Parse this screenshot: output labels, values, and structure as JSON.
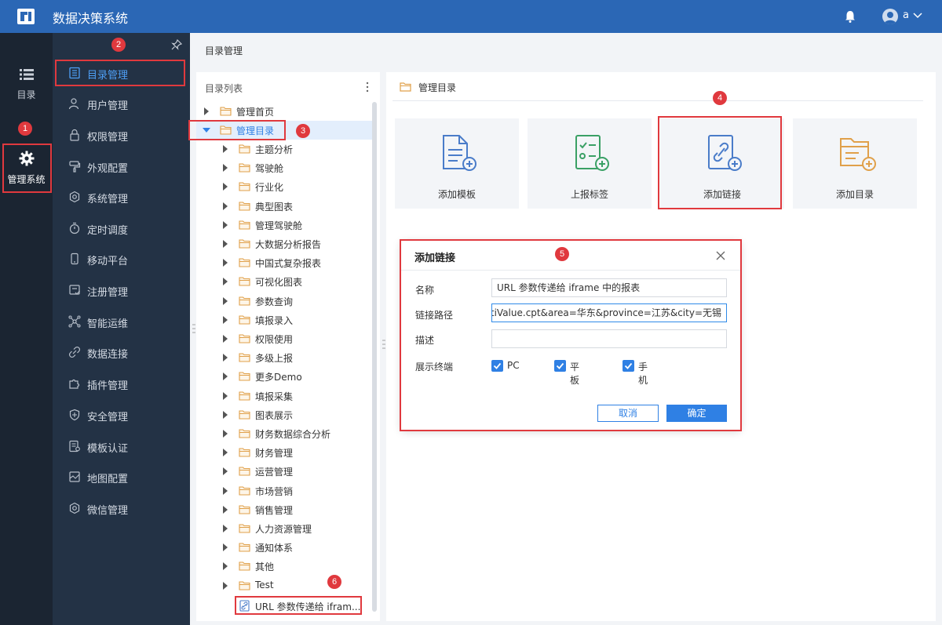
{
  "app": {
    "title": "数据决策系统",
    "user": "a"
  },
  "rail": [
    {
      "label": "目录",
      "icon": "list-icon"
    },
    {
      "label": "管理系统",
      "icon": "gear-icon"
    }
  ],
  "nav": [
    {
      "label": "目录管理",
      "icon": "doc-list-icon",
      "active": true
    },
    {
      "label": "用户管理",
      "icon": "user-icon"
    },
    {
      "label": "权限管理",
      "icon": "lock-icon"
    },
    {
      "label": "外观配置",
      "icon": "brush-icon"
    },
    {
      "label": "系统管理",
      "icon": "settings-icon"
    },
    {
      "label": "定时调度",
      "icon": "timer-icon"
    },
    {
      "label": "移动平台",
      "icon": "mobile-icon"
    },
    {
      "label": "注册管理",
      "icon": "register-icon"
    },
    {
      "label": "智能运维",
      "icon": "network-icon"
    },
    {
      "label": "数据连接",
      "icon": "link-icon"
    },
    {
      "label": "插件管理",
      "icon": "puzzle-icon"
    },
    {
      "label": "安全管理",
      "icon": "shield-icon"
    },
    {
      "label": "模板认证",
      "icon": "cert-icon"
    },
    {
      "label": "地图配置",
      "icon": "map-icon"
    },
    {
      "label": "微信管理",
      "icon": "wechat-icon"
    }
  ],
  "breadcrumb": "目录管理",
  "tree": {
    "title": "目录列表",
    "roots": [
      {
        "label": "管理首页",
        "expanded": false
      },
      {
        "label": "管理目录",
        "expanded": true,
        "selected": true
      }
    ],
    "children": [
      "主题分析",
      "驾驶舱",
      "行业化",
      "典型图表",
      "管理驾驶舱",
      "大数据分析报告",
      "中国式复杂报表",
      "可视化图表",
      "参数查询",
      "填报录入",
      "权限使用",
      "多级上报",
      "更多Demo",
      "填报采集",
      "图表展示",
      "财务数据综合分析",
      "财务管理",
      "运营管理",
      "市场营销",
      "销售管理",
      "人力资源管理",
      "通知体系",
      "其他",
      "Test"
    ],
    "link_item": "URL 参数传递给 ifram..."
  },
  "main": {
    "title": "管理目录",
    "cards": [
      {
        "label": "添加模板",
        "icon": "template-add-icon",
        "color": "#4a7cc9"
      },
      {
        "label": "上报标签",
        "icon": "checklist-add-icon",
        "color": "#3aa065"
      },
      {
        "label": "添加链接",
        "icon": "link-add-icon",
        "color": "#4a7cc9"
      },
      {
        "label": "添加目录",
        "icon": "folder-add-icon",
        "color": "#e0a04a"
      }
    ]
  },
  "dialog": {
    "title": "添加链接",
    "fields": {
      "name_label": "名称",
      "name_value": "URL 参数传递给 iframe 中的报表",
      "path_label": "链接路径",
      "path_value": "MultiValue.cpt&area=华东&province=江苏&city=无锡",
      "desc_label": "描述",
      "desc_value": "",
      "terminal_label": "展示终端"
    },
    "checkboxes": [
      {
        "label": "PC",
        "checked": true
      },
      {
        "label": "平板",
        "checked": true
      },
      {
        "label": "手机",
        "checked": true
      }
    ],
    "cancel": "取消",
    "ok": "确定"
  },
  "badges": [
    "1",
    "2",
    "3",
    "4",
    "5",
    "6"
  ],
  "colors": {
    "topbar": "#2b67b5",
    "rail": "#1b2532",
    "nav": "#233245",
    "accent": "#2f80e4",
    "annotation": "#e0393e"
  }
}
